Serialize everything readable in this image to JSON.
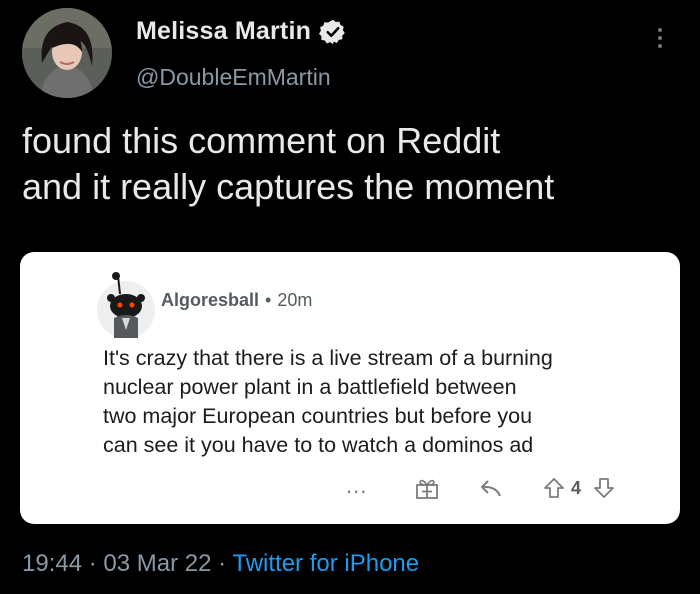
{
  "author": {
    "display_name": "Melissa Martin",
    "handle": "@DoubleEmMartin",
    "verified": true,
    "avatar_icon": "profile-photo"
  },
  "tweet": {
    "text_line1": "found this comment on Reddit",
    "text_line2": "and it really captures the moment"
  },
  "reddit_comment": {
    "username": "Algoresball",
    "separator": "•",
    "age": "20m",
    "body_lines": [
      "It's crazy that there is a live stream of a burning",
      "nuclear power plant in a battlefield between",
      "two major European countries but before you",
      "can see it you have to to watch a dominos ad"
    ],
    "actions": {
      "more": "...",
      "score": "4",
      "icons": [
        "award-icon",
        "reply-icon",
        "upvote-icon",
        "downvote-icon"
      ]
    }
  },
  "meta": {
    "time": "19:44",
    "date": "03 Mar 22",
    "separator": "·",
    "source": "Twitter for iPhone"
  },
  "colors": {
    "background": "#000000",
    "link": "#1d9bf0",
    "verified": "#e7e9ea",
    "secondary_text": "#8b98a5"
  }
}
